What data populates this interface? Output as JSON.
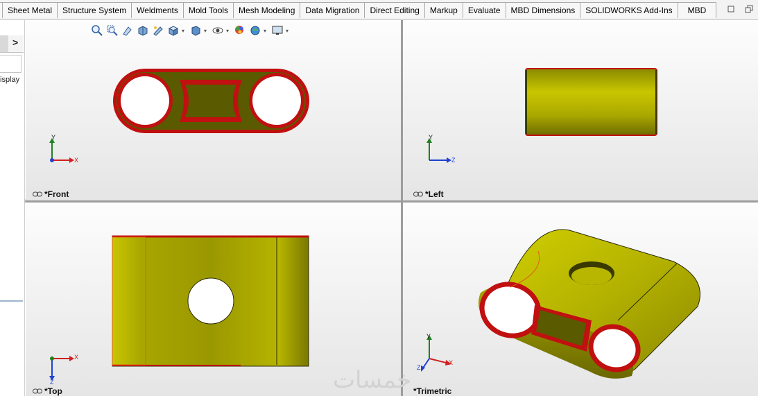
{
  "tabs": [
    "Sheet Metal",
    "Structure System",
    "Weldments",
    "Mold Tools",
    "Mesh Modeling",
    "Data Migration",
    "Direct Editing",
    "Markup",
    "Evaluate",
    "MBD Dimensions",
    "SOLIDWORKS Add-Ins",
    "MBD"
  ],
  "left_pane": {
    "display_text": "isplay",
    "chevron": ">"
  },
  "viewports": {
    "front": {
      "label": "*Front",
      "axes": [
        "Y",
        "X"
      ]
    },
    "left": {
      "label": "*Left",
      "axes": [
        "Y",
        "Z"
      ]
    },
    "top": {
      "label": "*Top",
      "axes": [
        "X",
        "Z"
      ]
    },
    "trimetric": {
      "label": "*Trimetric",
      "axes": [
        "Y",
        "Z",
        "X"
      ]
    }
  },
  "toolbar_icons": [
    "zoom-to-fit-icon",
    "zoom-to-area-icon",
    "previous-view-icon",
    "section-view-icon",
    "dynamic-annotation-icon",
    "view-orientation-icon",
    "display-style-icon",
    "hide-show-items-icon",
    "edit-appearance-icon",
    "apply-scene-icon",
    "view-settings-icon"
  ],
  "colors": {
    "model_yellow": "#b9b700",
    "model_dark": "#5a5a00",
    "edge_red": "#c01010",
    "axis_x": "#d02020",
    "axis_y": "#208020",
    "axis_z": "#2040d0"
  },
  "watermark": "خمسات"
}
